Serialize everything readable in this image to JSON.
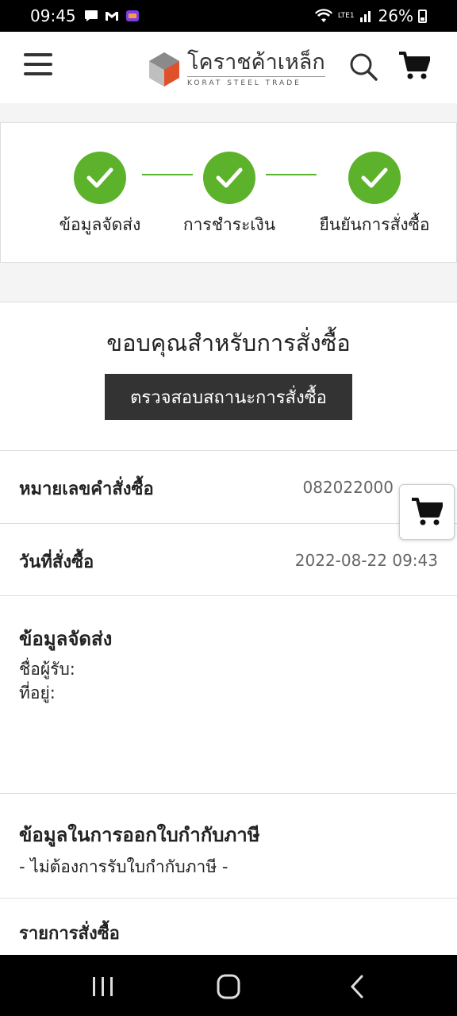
{
  "status_bar": {
    "time": "09:45",
    "battery": "26%",
    "network": "LTE1"
  },
  "header": {
    "logo_th": "โคราชค้าเหล็ก",
    "logo_en": "KORAT STEEL TRADE"
  },
  "steps": [
    {
      "label": "ข้อมูลจัดส่ง"
    },
    {
      "label": "การชำระเงิน"
    },
    {
      "label": "ยืนยันการสั่งซื้อ"
    }
  ],
  "thanks_text": "ขอบคุณสำหรับการสั่งซื้อ",
  "check_status_button": "ตรวจสอบสถานะการสั่งซื้อ",
  "order_number": {
    "label": "หมายเลขคำสั่งซื้อ",
    "value": "082022000"
  },
  "order_date": {
    "label": "วันที่สั่งซื้อ",
    "value": "2022-08-22 09:43"
  },
  "shipping": {
    "title": "ข้อมูลจัดส่ง",
    "recipient_label": "ชื่อผู้รับ:",
    "address_label": "ที่อยู่:"
  },
  "tax_invoice": {
    "title": "ข้อมูลในการออกใบกำกับภาษี",
    "value": "- ไม่ต้องการรับใบกำกับภาษี -"
  },
  "order_items": {
    "title": "รายการสั่งซื้อ"
  },
  "colors": {
    "step_green": "#5db22c",
    "button_dark": "#333333",
    "logo_orange": "#e0502a"
  }
}
